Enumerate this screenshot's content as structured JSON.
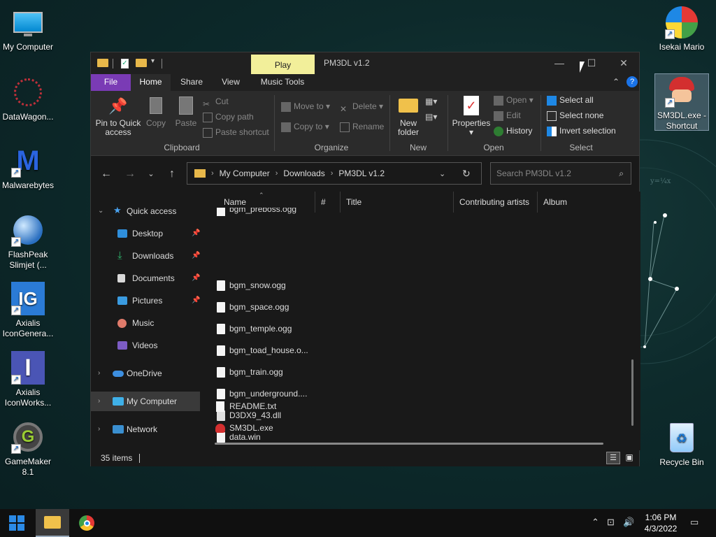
{
  "desktop": {
    "icons": [
      {
        "label": "My Computer"
      },
      {
        "label": "DataWagon..."
      },
      {
        "label": "Malwarebytes"
      },
      {
        "label": "FlashPeak Slimjet (..."
      },
      {
        "label": "Axialis IconGenera..."
      },
      {
        "label": "Axialis IconWorks..."
      },
      {
        "label": "GameMaker 8.1"
      },
      {
        "label": "Isekai Mario"
      },
      {
        "label": "SM3DL.exe - Shortcut"
      },
      {
        "label": "Recycle Bin"
      }
    ]
  },
  "window": {
    "title": "PM3DL v1.2",
    "context_tab": "Play",
    "tabs": {
      "file": "File",
      "home": "Home",
      "share": "Share",
      "view": "View",
      "music_tools": "Music Tools"
    },
    "ribbon": {
      "clipboard": {
        "label": "Clipboard",
        "pin": "Pin to Quick access",
        "copy": "Copy",
        "paste": "Paste",
        "cut": "Cut",
        "copy_path": "Copy path",
        "paste_shortcut": "Paste shortcut"
      },
      "organize": {
        "label": "Organize",
        "move_to": "Move to",
        "copy_to": "Copy to",
        "delete": "Delete",
        "rename": "Rename"
      },
      "new": {
        "label": "New",
        "new_folder": "New folder"
      },
      "open": {
        "label": "Open",
        "properties": "Properties",
        "open": "Open",
        "edit": "Edit",
        "history": "History"
      },
      "select": {
        "label": "Select",
        "select_all": "Select all",
        "select_none": "Select none",
        "invert": "Invert selection"
      }
    },
    "address": {
      "crumbs": [
        "My Computer",
        "Downloads",
        "PM3DL v1.2"
      ]
    },
    "search": {
      "placeholder": "Search PM3DL v1.2"
    },
    "navpane": {
      "quick_access": "Quick access",
      "desktop": "Desktop",
      "downloads": "Downloads",
      "documents": "Documents",
      "pictures": "Pictures",
      "music": "Music",
      "videos": "Videos",
      "onedrive": "OneDrive",
      "my_computer": "My Computer",
      "network": "Network"
    },
    "columns": {
      "name": "Name",
      "num": "#",
      "title": "Title",
      "artists": "Contributing artists",
      "album": "Album"
    },
    "files": [
      {
        "name": "bgm_preboss.ogg"
      },
      {
        "name": "bgm_snow.ogg"
      },
      {
        "name": "bgm_space.ogg"
      },
      {
        "name": "bgm_temple.ogg"
      },
      {
        "name": "bgm_toad_house.o..."
      },
      {
        "name": "bgm_train.ogg"
      },
      {
        "name": "bgm_underground...."
      },
      {
        "name": "D3DX9_43.dll"
      },
      {
        "name": "data.win"
      },
      {
        "name": "README.txt"
      },
      {
        "name": "SM3DL.exe"
      }
    ],
    "status": {
      "count": "35 items"
    }
  },
  "taskbar": {
    "time": "1:06 PM",
    "date": "4/3/2022"
  },
  "colors": {
    "accent_file_tab": "#7a3bb5",
    "play_tab": "#f2ef9a",
    "window_bg": "#191919",
    "ribbon_bg": "#2b2b2b"
  }
}
